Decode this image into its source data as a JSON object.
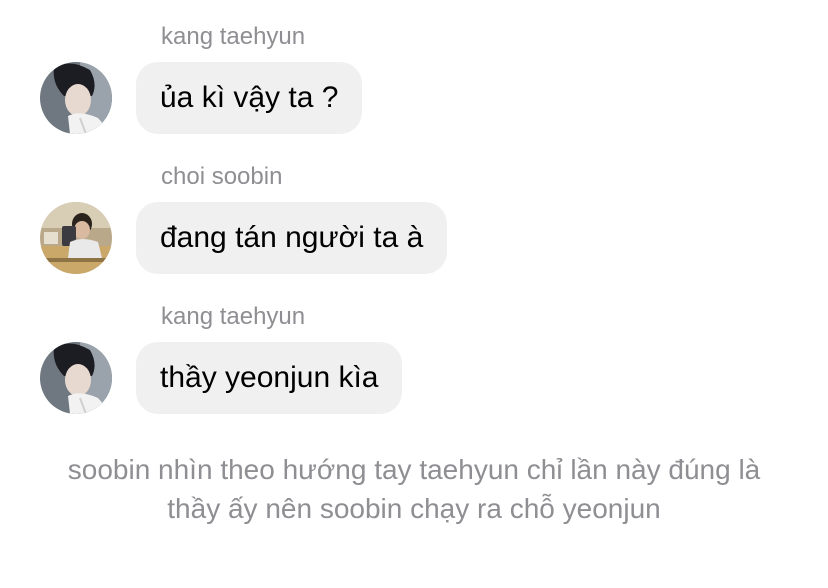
{
  "colors": {
    "background": "#ffffff",
    "bubble": "#f0f0f0",
    "sender_name": "#8e8e93",
    "message_text": "#000000",
    "narration_text": "#8e8e93"
  },
  "messages": [
    {
      "sender": "kang taehyun",
      "avatar_icon": "user-avatar-photo",
      "text": "ủa kì vậy ta ?"
    },
    {
      "sender": "choi soobin",
      "avatar_icon": "user-avatar-photo",
      "text": "đang tán người ta à"
    },
    {
      "sender": "kang taehyun",
      "avatar_icon": "user-avatar-photo",
      "text": "thầy yeonjun kìa"
    }
  ],
  "narration": {
    "text": "soobin nhìn theo hướng tay taehyun chỉ lần này đúng là thầy ấy nên soobin chạy ra chỗ yeonjun"
  }
}
